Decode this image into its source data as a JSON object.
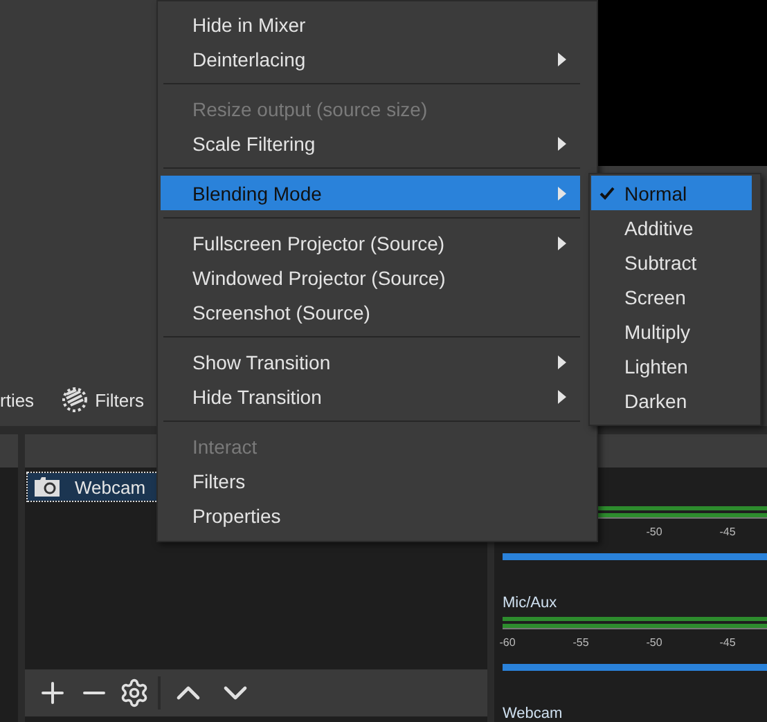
{
  "toolbar": {
    "items": [
      {
        "kind": "text",
        "label": "rties"
      },
      {
        "kind": "button",
        "label": "Filters"
      }
    ]
  },
  "sources": {
    "items": [
      {
        "name": "Webcam",
        "selected": true
      }
    ]
  },
  "mixer": {
    "tracks": [
      {
        "ticks": [
          "-50",
          "-45"
        ],
        "level": 1
      },
      {
        "name": "Mic/Aux",
        "ticks": [
          "-60",
          "-55",
          "-50",
          "-45"
        ],
        "level": 1
      },
      {
        "name": "Webcam"
      }
    ]
  },
  "context_menu": {
    "items": [
      {
        "kind": "item",
        "label": "Hide in Mixer",
        "disabled": false,
        "submenu": false,
        "highlighted": false
      },
      {
        "kind": "item",
        "label": "Deinterlacing",
        "disabled": false,
        "submenu": true,
        "highlighted": false
      },
      {
        "kind": "separator"
      },
      {
        "kind": "item",
        "label": "Resize output (source size)",
        "disabled": true,
        "submenu": false,
        "highlighted": false
      },
      {
        "kind": "item",
        "label": "Scale Filtering",
        "disabled": false,
        "submenu": true,
        "highlighted": false
      },
      {
        "kind": "separator"
      },
      {
        "kind": "item",
        "label": "Blending Mode",
        "disabled": false,
        "submenu": true,
        "highlighted": true
      },
      {
        "kind": "separator"
      },
      {
        "kind": "item",
        "label": "Fullscreen Projector (Source)",
        "disabled": false,
        "submenu": true,
        "highlighted": false
      },
      {
        "kind": "item",
        "label": "Windowed Projector (Source)",
        "disabled": false,
        "submenu": false,
        "highlighted": false
      },
      {
        "kind": "item",
        "label": "Screenshot (Source)",
        "disabled": false,
        "submenu": false,
        "highlighted": false
      },
      {
        "kind": "separator"
      },
      {
        "kind": "item",
        "label": "Show Transition",
        "disabled": false,
        "submenu": true,
        "highlighted": false
      },
      {
        "kind": "item",
        "label": "Hide Transition",
        "disabled": false,
        "submenu": true,
        "highlighted": false
      },
      {
        "kind": "separator"
      },
      {
        "kind": "item",
        "label": "Interact",
        "disabled": true,
        "submenu": false,
        "highlighted": false
      },
      {
        "kind": "item",
        "label": "Filters",
        "disabled": false,
        "submenu": false,
        "highlighted": false
      },
      {
        "kind": "item",
        "label": "Properties",
        "disabled": false,
        "submenu": false,
        "highlighted": false
      }
    ]
  },
  "blending_submenu": {
    "items": [
      {
        "label": "Normal",
        "selected": true
      },
      {
        "label": "Additive",
        "selected": false
      },
      {
        "label": "Subtract",
        "selected": false
      },
      {
        "label": "Screen",
        "selected": false
      },
      {
        "label": "Multiply",
        "selected": false
      },
      {
        "label": "Lighten",
        "selected": false
      },
      {
        "label": "Darken",
        "selected": false
      }
    ]
  }
}
